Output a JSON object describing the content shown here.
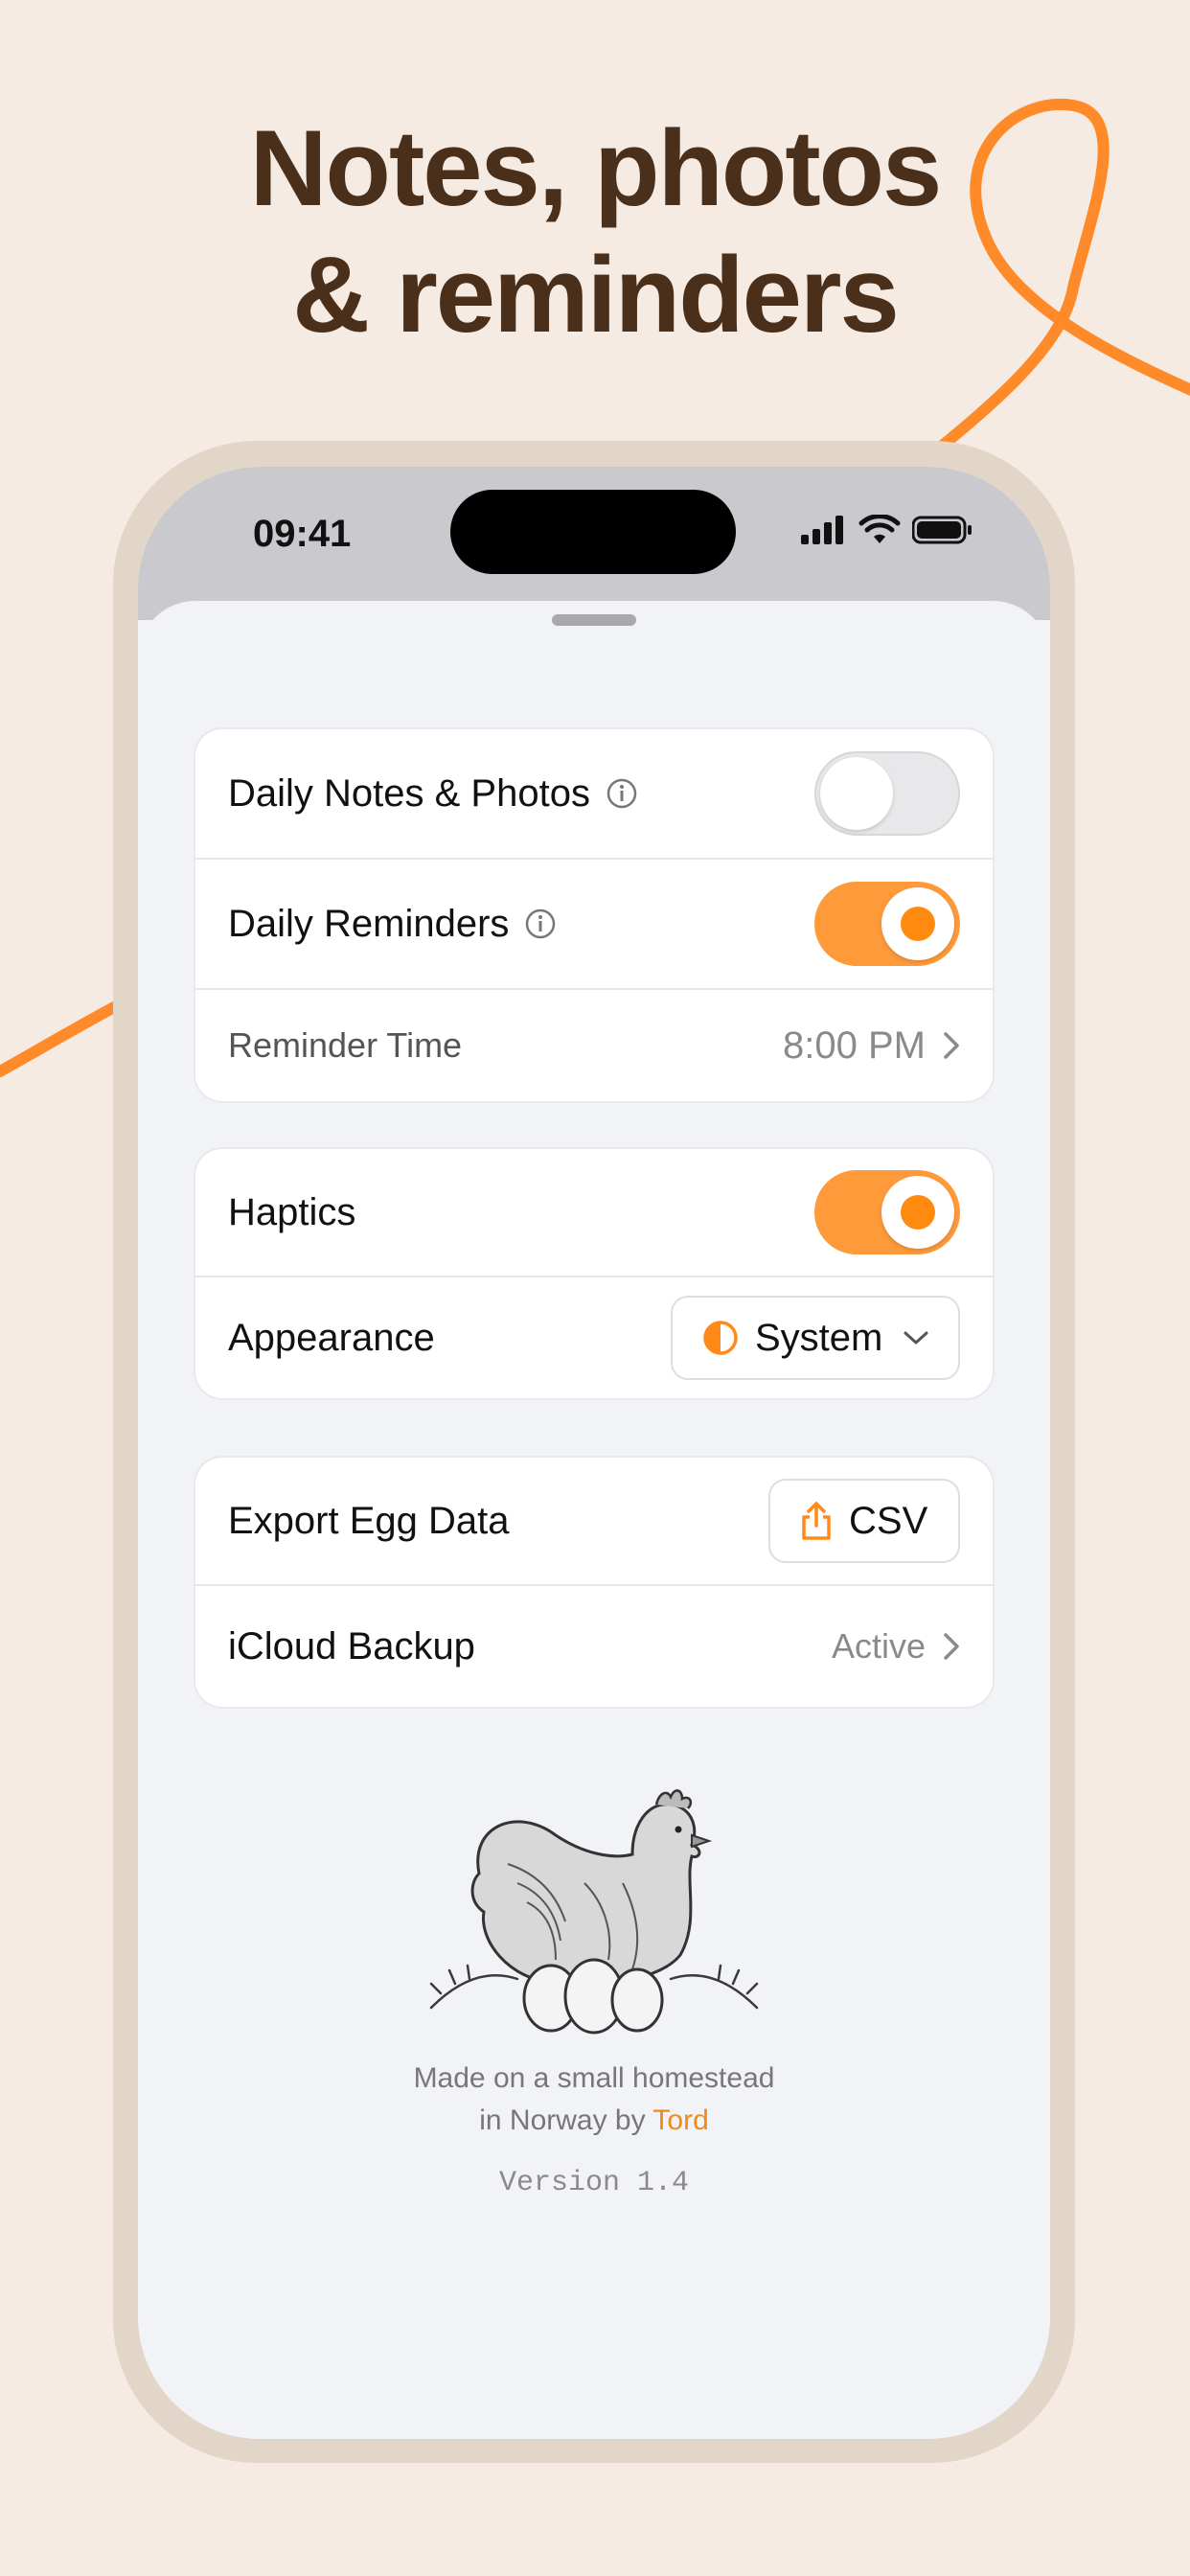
{
  "headline": {
    "line1": "Notes, photos",
    "line2": "& reminders"
  },
  "colors": {
    "background": "#f6ebe2",
    "accent": "#ff8a1a",
    "headline": "#4a2f1a"
  },
  "status_bar": {
    "time": "09:41",
    "icons": [
      "signal-icon",
      "wifi-icon",
      "battery-icon"
    ]
  },
  "settings": {
    "group1": {
      "daily_notes": {
        "label": "Daily Notes & Photos",
        "enabled": false
      },
      "daily_reminders": {
        "label": "Daily Reminders",
        "enabled": true
      },
      "reminder_time": {
        "label": "Reminder Time",
        "value": "8:00 PM"
      }
    },
    "group2": {
      "haptics": {
        "label": "Haptics",
        "enabled": true
      },
      "appearance": {
        "label": "Appearance",
        "value": "System"
      }
    },
    "group3": {
      "export": {
        "label": "Export Egg Data",
        "button_label": "CSV"
      },
      "icloud": {
        "label": "iCloud Backup",
        "value": "Active"
      }
    }
  },
  "footer": {
    "line1": "Made on a small homestead",
    "line2_prefix": "in Norway by ",
    "author": "Tord",
    "version": "Version 1.4"
  }
}
